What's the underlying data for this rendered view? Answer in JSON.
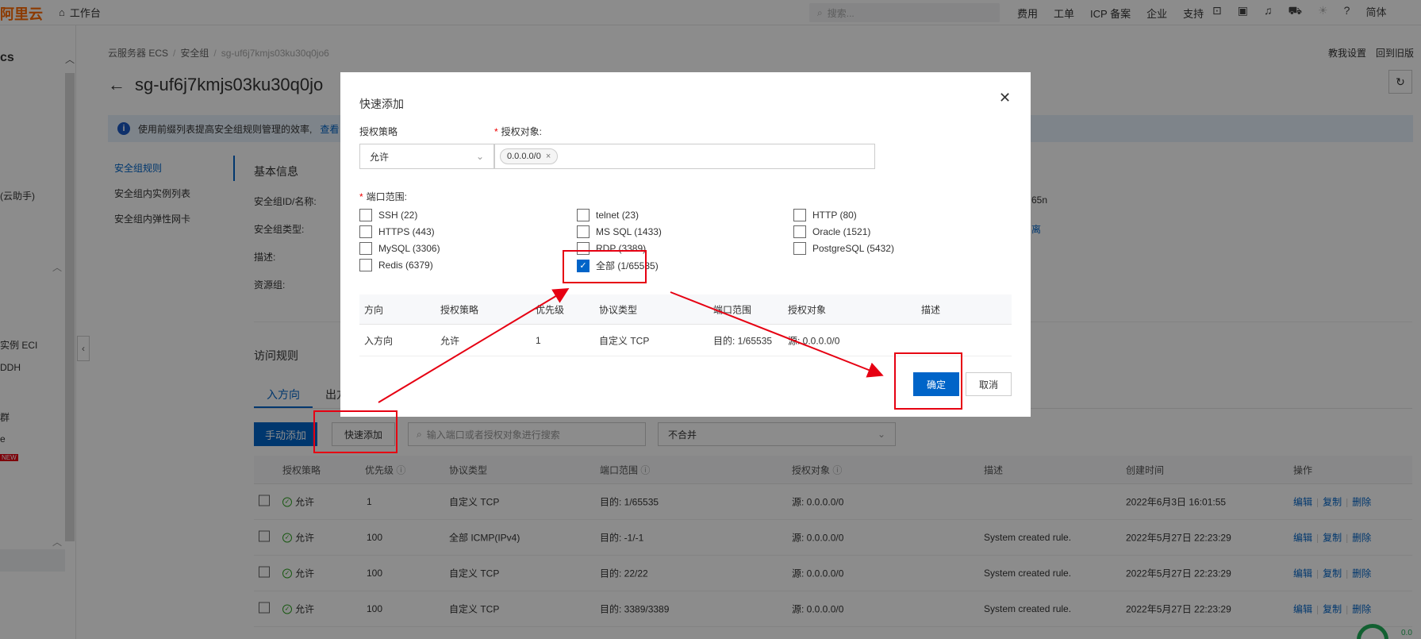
{
  "topbar": {
    "logo": "阿里云",
    "workbench": "工作台",
    "search_placeholder": "搜索...",
    "nav": [
      "费用",
      "工单",
      "ICP 备案",
      "企业",
      "支持"
    ],
    "lang": "简体"
  },
  "sidebar": {
    "title": "cs",
    "items": [
      "(云助手)",
      "实例 ECI",
      "DDH",
      "群",
      "e",
      "NEW"
    ]
  },
  "breadcrumb": [
    "云服务器 ECS",
    "安全组",
    "sg-uf6j7kmjs03ku30q0jo6"
  ],
  "page_title": "sg-uf6j7kmjs03ku30q0jo",
  "help_links": [
    "教我设置",
    "回到旧版"
  ],
  "info_bar": {
    "text": "使用前缀列表提高安全组规则管理的效率,",
    "link": "查看"
  },
  "subnav": [
    "安全组规则",
    "安全组内实例列表",
    "安全组内弹性网卡"
  ],
  "basic_info": {
    "title": "基本信息",
    "labels": [
      "安全组ID/名称:",
      "安全组类型:",
      "描述:",
      "资源组:"
    ],
    "right_value": "65n",
    "right_link": "离"
  },
  "access_rules": {
    "title": "访问规则",
    "tabs": [
      "入方向",
      "出方"
    ]
  },
  "toolbar": {
    "manual_add": "手动添加",
    "quick_add": "快速添加",
    "search_placeholder": "输入端口或者授权对象进行搜索",
    "merge_select": "不合并"
  },
  "rules_table": {
    "headers": [
      "授权策略",
      "优先级",
      "协议类型",
      "端口范围",
      "授权对象",
      "描述",
      "创建时间",
      "操作"
    ],
    "rows": [
      {
        "policy": "允许",
        "priority": "1",
        "protocol": "自定义 TCP",
        "port": "目的: 1/65535",
        "target": "源: 0.0.0.0/0",
        "desc": "",
        "time": "2022年6月3日 16:01:55"
      },
      {
        "policy": "允许",
        "priority": "100",
        "protocol": "全部 ICMP(IPv4)",
        "port": "目的: -1/-1",
        "target": "源: 0.0.0.0/0",
        "desc": "System created rule.",
        "time": "2022年5月27日 22:23:29"
      },
      {
        "policy": "允许",
        "priority": "100",
        "protocol": "自定义 TCP",
        "port": "目的: 22/22",
        "target": "源: 0.0.0.0/0",
        "desc": "System created rule.",
        "time": "2022年5月27日 22:23:29"
      },
      {
        "policy": "允许",
        "priority": "100",
        "protocol": "自定义 TCP",
        "port": "目的: 3389/3389",
        "target": "源: 0.0.0.0/0",
        "desc": "System created rule.",
        "time": "2022年5月27日 22:23:29"
      }
    ],
    "ops": [
      "编辑",
      "复制",
      "删除"
    ]
  },
  "modal": {
    "title": "快速添加",
    "policy_label": "授权策略",
    "policy_value": "允许",
    "target_label": "授权对象:",
    "target_tag": "0.0.0.0/0",
    "port_label": "端口范围:",
    "ports": [
      {
        "label": "SSH (22)",
        "checked": false
      },
      {
        "label": "telnet (23)",
        "checked": false
      },
      {
        "label": "HTTP (80)",
        "checked": false
      },
      {
        "label": "HTTPS (443)",
        "checked": false
      },
      {
        "label": "MS SQL (1433)",
        "checked": false
      },
      {
        "label": "Oracle (1521)",
        "checked": false
      },
      {
        "label": "MySQL (3306)",
        "checked": false
      },
      {
        "label": "RDP (3389)",
        "checked": false
      },
      {
        "label": "PostgreSQL (5432)",
        "checked": false
      },
      {
        "label": "Redis (6379)",
        "checked": false
      },
      {
        "label": "全部 (1/65535)",
        "checked": true
      }
    ],
    "preview_headers": [
      "方向",
      "授权策略",
      "优先级",
      "协议类型",
      "端口范围",
      "授权对象",
      "描述"
    ],
    "preview_row": {
      "direction": "入方向",
      "policy": "允许",
      "priority": "1",
      "protocol": "自定义 TCP",
      "port": "目的: 1/65535",
      "target": "源: 0.0.0.0/0",
      "desc": ""
    },
    "ok": "确定",
    "cancel": "取消"
  },
  "badge_text": "0.0",
  "colors": {
    "primary": "#0064c8",
    "annotation": "#e60012",
    "brand": "#ff6a00"
  }
}
